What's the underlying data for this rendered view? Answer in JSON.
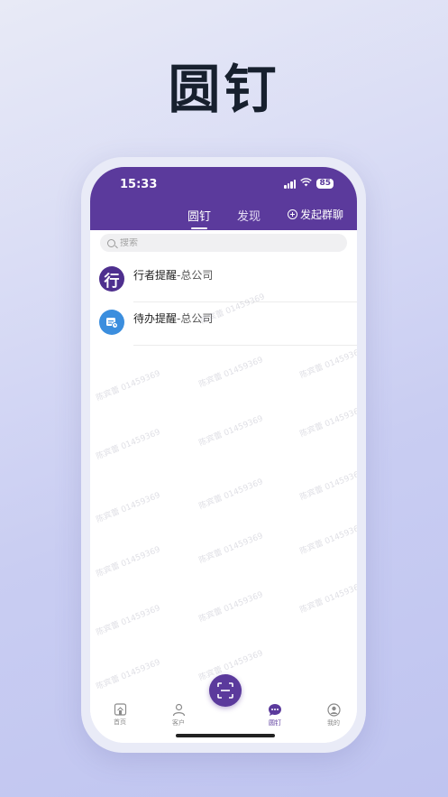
{
  "hero": {
    "title": "圆钉"
  },
  "status_bar": {
    "time": "15:33",
    "battery": "85"
  },
  "tabs": {
    "active": "圆钉",
    "discover": "发现",
    "group_chat": "发起群聊"
  },
  "search": {
    "placeholder": "搜索"
  },
  "list": [
    {
      "avatar_char": "行",
      "title": "行者提醒",
      "org": "-总公司"
    },
    {
      "avatar_char": "",
      "title": "待办提醒",
      "org": "-总公司"
    }
  ],
  "watermark": {
    "text": "陈宾蕾 01459369"
  },
  "tabbar": {
    "home": "首页",
    "customer": "客户",
    "pin": "圆钉",
    "mine": "我的"
  },
  "colors": {
    "brand": "#5b3a9c",
    "blue_avatar": "#3b8ede"
  }
}
